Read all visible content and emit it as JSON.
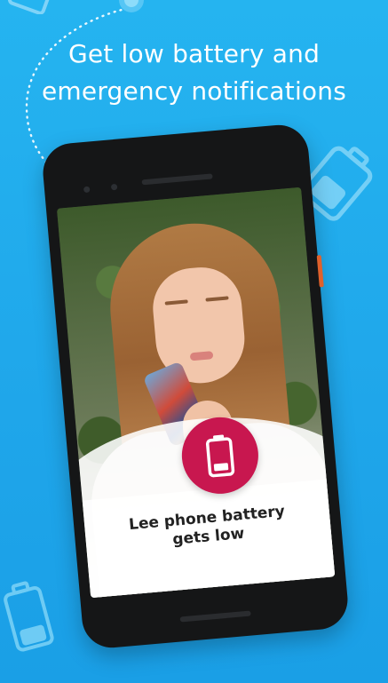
{
  "headline": {
    "line1": "Get low battery and",
    "line2": "emergency notifications"
  },
  "screen": {
    "notification_line1": "Lee phone battery",
    "notification_line2": "gets low"
  },
  "icons": {
    "badge_icon": "battery-low-icon",
    "decorative": [
      "battery-icon",
      "battery-icon",
      "location-pin-icon"
    ]
  },
  "colors": {
    "background": "#1fa6ea",
    "badge": "#c8174f",
    "headline_text": "#ffffff"
  }
}
